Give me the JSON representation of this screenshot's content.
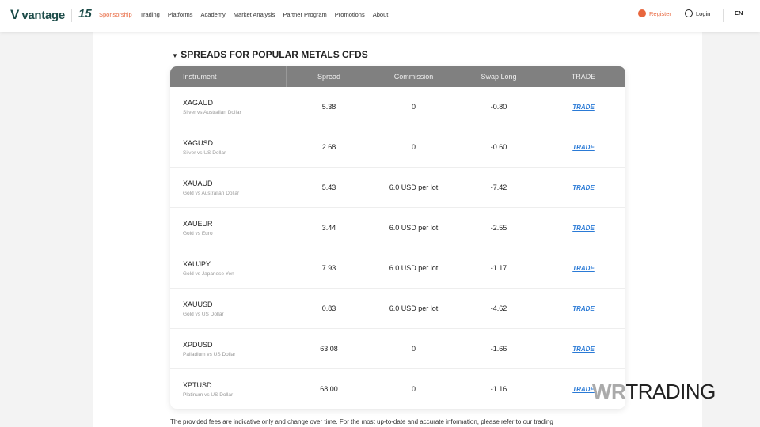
{
  "header": {
    "logo": "vantage",
    "anniversary": "15",
    "nav": [
      "Sponsorship",
      "Trading",
      "Platforms",
      "Academy",
      "Market Analysis",
      "Partner Program",
      "Promotions",
      "About"
    ],
    "register": "Register",
    "login": "Login",
    "lang": "EN"
  },
  "section": {
    "title": "SPREADS FOR POPULAR METALS CFDS"
  },
  "table": {
    "columns": [
      "Instrument",
      "Spread",
      "Commission",
      "Swap Long",
      "TRADE"
    ],
    "rows": [
      {
        "symbol": "XAGAUD",
        "name": "Silver vs Australian Dollar",
        "spread": "5.38",
        "commission": "0",
        "swap_long": "-0.80",
        "trade": "TRADE"
      },
      {
        "symbol": "XAGUSD",
        "name": "Silver vs US Dollar",
        "spread": "2.68",
        "commission": "0",
        "swap_long": "-0.60",
        "trade": "TRADE"
      },
      {
        "symbol": "XAUAUD",
        "name": "Gold vs Australian Dollar",
        "spread": "5.43",
        "commission": "6.0 USD per lot",
        "swap_long": "-7.42",
        "trade": "TRADE"
      },
      {
        "symbol": "XAUEUR",
        "name": "Gold vs Euro",
        "spread": "3.44",
        "commission": "6.0 USD per lot",
        "swap_long": "-2.55",
        "trade": "TRADE"
      },
      {
        "symbol": "XAUJPY",
        "name": "Gold vs Japanese Yen",
        "spread": "7.93",
        "commission": "6.0 USD per lot",
        "swap_long": "-1.17",
        "trade": "TRADE"
      },
      {
        "symbol": "XAUUSD",
        "name": "Gold vs US Dollar",
        "spread": "0.83",
        "commission": "6.0 USD per lot",
        "swap_long": "-4.62",
        "trade": "TRADE"
      },
      {
        "symbol": "XPDUSD",
        "name": "Palladium vs US Dollar",
        "spread": "63.08",
        "commission": "0",
        "swap_long": "-1.66",
        "trade": "TRADE"
      },
      {
        "symbol": "XPTUSD",
        "name": "Platinum vs US Dollar",
        "spread": "68.00",
        "commission": "0",
        "swap_long": "-1.16",
        "trade": "TRADE"
      }
    ]
  },
  "note": "The provided fees are indicative only and change over time. For the most up-to-date and accurate information, please refer to our trading",
  "watermark": {
    "a": "WR",
    "b": "TRADING"
  }
}
